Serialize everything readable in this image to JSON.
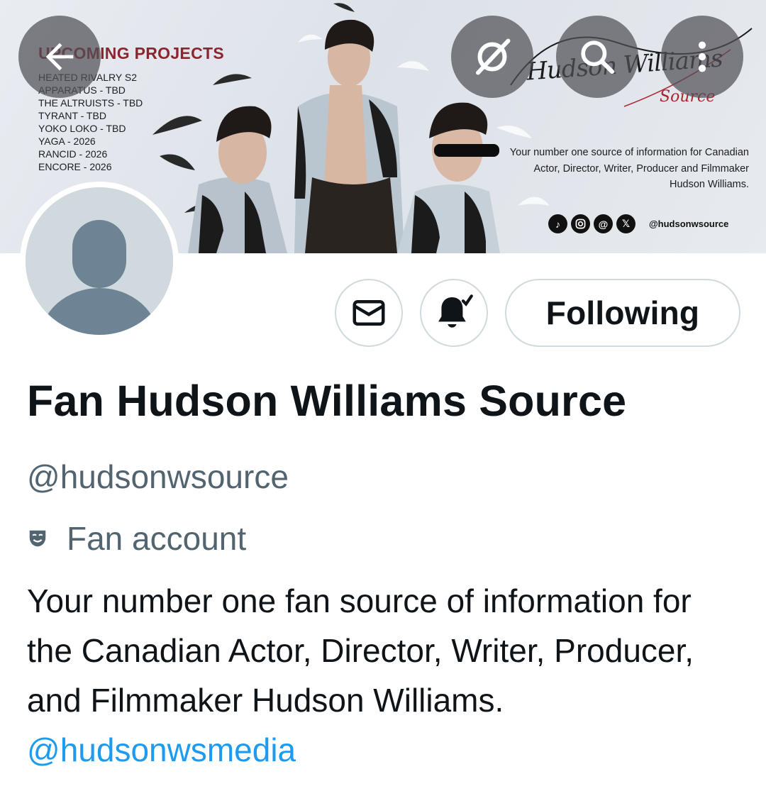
{
  "banner": {
    "projects_title": "UPCOMING PROJECTS",
    "projects": [
      "HEATED RIVALRY S2",
      "APPARATUS - TBD",
      "THE ALTRUISTS - TBD",
      "TYRANT - TBD",
      "YOKO LOKO - TBD",
      "YAGA - 2026",
      "RANCID - 2026",
      "ENCORE - 2026"
    ],
    "logo_name": "Hudson Williams",
    "logo_sub": "Source",
    "tagline": "Your number one source of information for Canadian Actor, Director, Writer, Producer and Filmmaker Hudson Williams.",
    "social_handle": "@hudsonwsource",
    "social_icons": [
      "tiktok-icon",
      "instagram-icon",
      "threads-icon",
      "x-icon"
    ]
  },
  "nav": {
    "back_icon": "back-arrow-icon",
    "grok_icon": "grok-icon",
    "search_icon": "search-icon",
    "more_icon": "more-vertical-icon"
  },
  "actions": {
    "message_icon": "envelope-icon",
    "notify_icon": "bell-check-icon",
    "follow_label": "Following"
  },
  "profile": {
    "display_name": "Fan Hudson Williams Source",
    "handle": "@hudsonwsource",
    "account_label": "Fan account",
    "bio_text": "Your number one fan source of information for the Canadian Actor, Director, Writer, Producer, and Filmmaker Hudson Williams.",
    "bio_link": "@hudsonwsmedia"
  },
  "colors": {
    "accent": "#1d9bf0",
    "secondary_text": "#536471",
    "primary_text": "#0f1419",
    "border": "#cfd9de",
    "banner_title": "#8b2530"
  }
}
